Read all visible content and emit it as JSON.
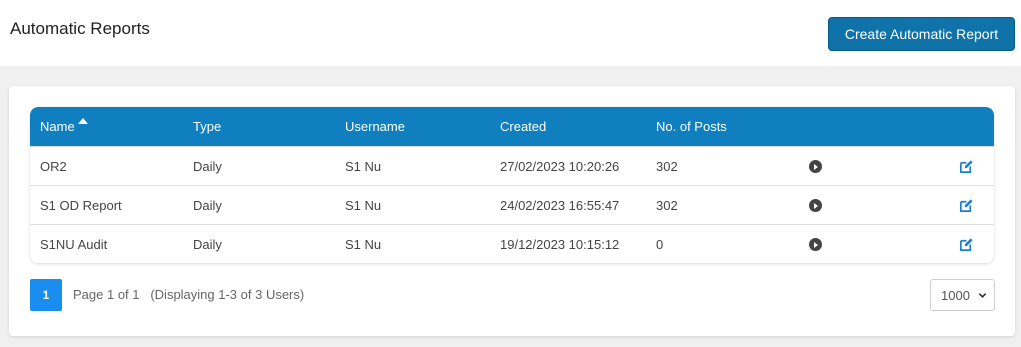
{
  "header": {
    "title": "Automatic Reports",
    "create_button": "Create Automatic Report"
  },
  "table": {
    "columns": {
      "name": "Name",
      "type": "Type",
      "username": "Username",
      "created": "Created",
      "posts": "No. of Posts"
    },
    "sort": {
      "column": "name",
      "direction": "ascending"
    },
    "rows": [
      {
        "name": "OR2",
        "type": "Daily",
        "username": "S1 Nu",
        "created": "27/02/2023 10:20:26",
        "posts": "302"
      },
      {
        "name": "S1 OD Report",
        "type": "Daily",
        "username": "S1 Nu",
        "created": "24/02/2023 16:55:47",
        "posts": "302"
      },
      {
        "name": "S1NU Audit",
        "type": "Daily",
        "username": "S1 Nu",
        "created": "19/12/2023 10:15:12",
        "posts": "0"
      }
    ],
    "row_icons": [
      "play-icon",
      "edit-icon"
    ]
  },
  "pagination": {
    "current_page": "1",
    "info": "Page 1 of 1   (Displaying 1-3 of 3 Users)",
    "page_size": "1000"
  },
  "colors": {
    "header_blue": "#0f7fc0",
    "button_blue": "#0f73aa",
    "page_button_blue": "#1a8ef0",
    "edit_icon_blue": "#1a7fd0"
  }
}
